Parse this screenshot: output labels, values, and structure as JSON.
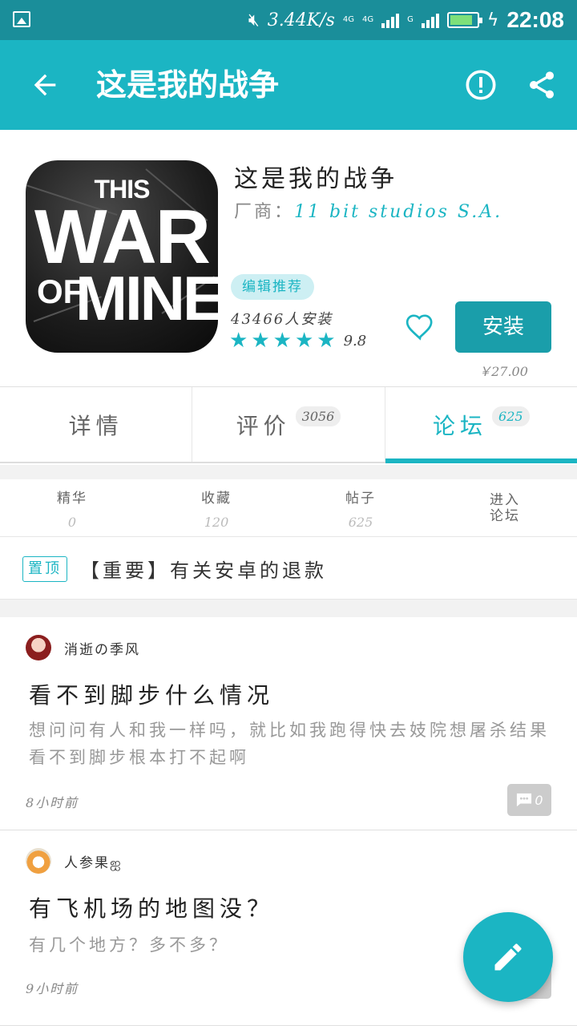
{
  "status_bar": {
    "network_speed": "3.44K/s",
    "net1": "4G",
    "net2": "4G",
    "net3": "G",
    "time": "22:08",
    "battery_level": 0.85,
    "battery_color": "#7ee07a"
  },
  "app_bar": {
    "title": "这是我的战争",
    "back_icon": "arrow-left",
    "report_icon": "exclamation-circle",
    "share_icon": "share",
    "color": "#1bb5c3"
  },
  "app": {
    "name": "这是我的战争",
    "vendor_label": "厂商：",
    "vendor_name": "11 bit studios S.A.",
    "icon_text": {
      "line1": "THIS",
      "line2": "WAR",
      "line3a": "OF",
      "line3b": "MINE"
    },
    "badge": "编辑推荐",
    "installs": "43466人安装",
    "stars": 5,
    "rating": "9.8",
    "install_label": "安装",
    "price": "￥27.00"
  },
  "tabs": [
    {
      "label": "详情",
      "count": ""
    },
    {
      "label": "评价",
      "count": "3056"
    },
    {
      "label": "论坛",
      "count": "625"
    }
  ],
  "active_tab": 2,
  "stats": [
    {
      "label": "精华",
      "value": "0"
    },
    {
      "label": "收藏",
      "value": "120"
    },
    {
      "label": "帖子",
      "value": "625"
    }
  ],
  "enter_forum": "进入论坛",
  "pinned": {
    "tag": "置顶",
    "text": "【重要】有关安卓的退款"
  },
  "posts": [
    {
      "author": "消逝の季风",
      "title": "看不到脚步什么情况",
      "body": "想问问有人和我一样吗，就比如我跑得快去妓院想屠杀结果看不到脚步根本打不起啊",
      "time": "8小时前",
      "comments": "0"
    },
    {
      "author": "人参果ஐ",
      "title": "有飞机场的地图没？",
      "body": "有几个地方？多不多？",
      "time": "9小时前",
      "comments": "0"
    }
  ]
}
